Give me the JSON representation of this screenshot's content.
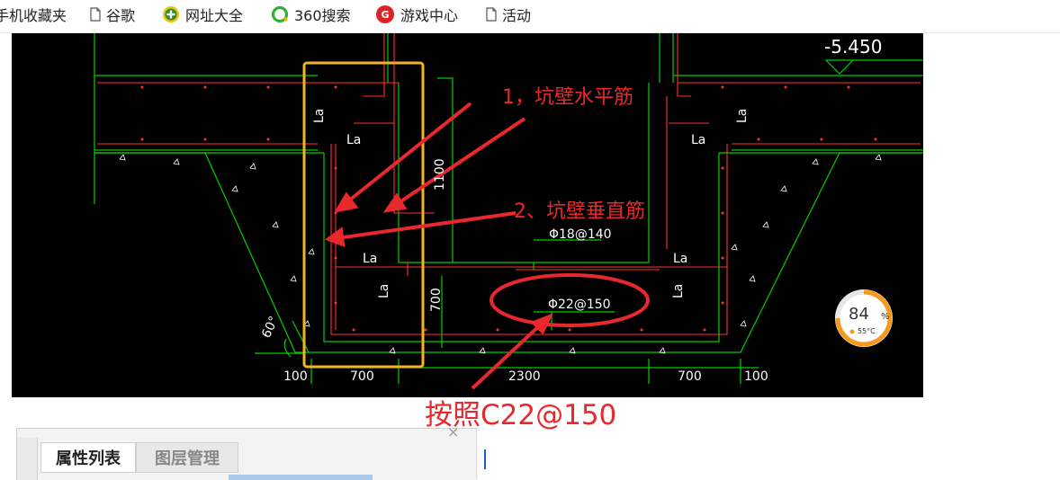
{
  "bookmarks": [
    {
      "label": "手机收藏夹",
      "icon": "none"
    },
    {
      "label": "谷歌",
      "icon": "page-icon"
    },
    {
      "label": "网址大全",
      "icon": "green-plus-icon"
    },
    {
      "label": "360搜索",
      "icon": "360-icon"
    },
    {
      "label": "游戏中心",
      "icon": "game-icon"
    },
    {
      "label": "活动",
      "icon": "page-icon"
    }
  ],
  "drawing": {
    "elevation": "-5.450",
    "annotation_1": "1，坑壁水平筋",
    "annotation_2": "2、坑壁垂直筋",
    "rebar_top": "Φ18@140",
    "rebar_bottom": "Φ22@150",
    "la": "La",
    "dim_1100": "1100",
    "dim_700": "700",
    "angle": "60°",
    "bottom_dims": [
      "100",
      "700",
      "2300",
      "700",
      "100"
    ],
    "gauge_value": "84",
    "gauge_unit": "%",
    "gauge_temp": "55°C",
    "colors": {
      "highlight": "#f0b323",
      "annotation": "#e8282c",
      "line_green": "#00d000",
      "line_red": "#ff3030"
    }
  },
  "caption": "按照C22@150",
  "panel": {
    "tab_active": "属性列表",
    "tab_inactive": "图层管理",
    "close": "×"
  }
}
